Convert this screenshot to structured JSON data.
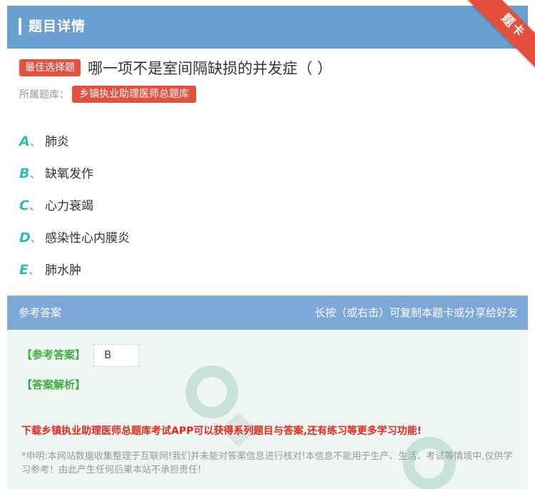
{
  "header": {
    "title": "题目详情"
  },
  "ribbon": {
    "text": "题卡"
  },
  "question": {
    "type_tag": "最佳选择题",
    "text": "哪一项不是室间隔缺损的并发症（ ）"
  },
  "bank": {
    "label": "所属题库：",
    "name": "乡镇执业助理医师总题库"
  },
  "options": [
    {
      "letter": "A",
      "sep": "、",
      "text": "肺炎"
    },
    {
      "letter": "B",
      "sep": "、",
      "text": "缺氧发作"
    },
    {
      "letter": "C",
      "sep": "、",
      "text": "心力衰竭"
    },
    {
      "letter": "D",
      "sep": "、",
      "text": "感染性心内膜炎"
    },
    {
      "letter": "E",
      "sep": "、",
      "text": "肺水肿"
    }
  ],
  "answer_section": {
    "title": "参考答案",
    "hint": "长按（或右击）可复制本题卡或分享给好友",
    "key_label": "【参考答案】",
    "key_value": "B",
    "analysis_label": "【答案解析】",
    "promo": "下载乡镇执业助理医师总题库考试APP可以获得系列题目与答案,还有练习等更多学习功能!",
    "disclaimer": "*申明:本网站数据收集整理于互联网!我们并未能对答案信息进行核对!本信息不能用于生产、生活、考试等情境中,仅供学习参考！由此产生任何后果本站不承担责任!"
  },
  "colors": {
    "header_bg": "#6a9fd1",
    "accent_red": "#e5503d",
    "option_letter": "#2bbfb3",
    "answer_green": "#3fae3a"
  }
}
